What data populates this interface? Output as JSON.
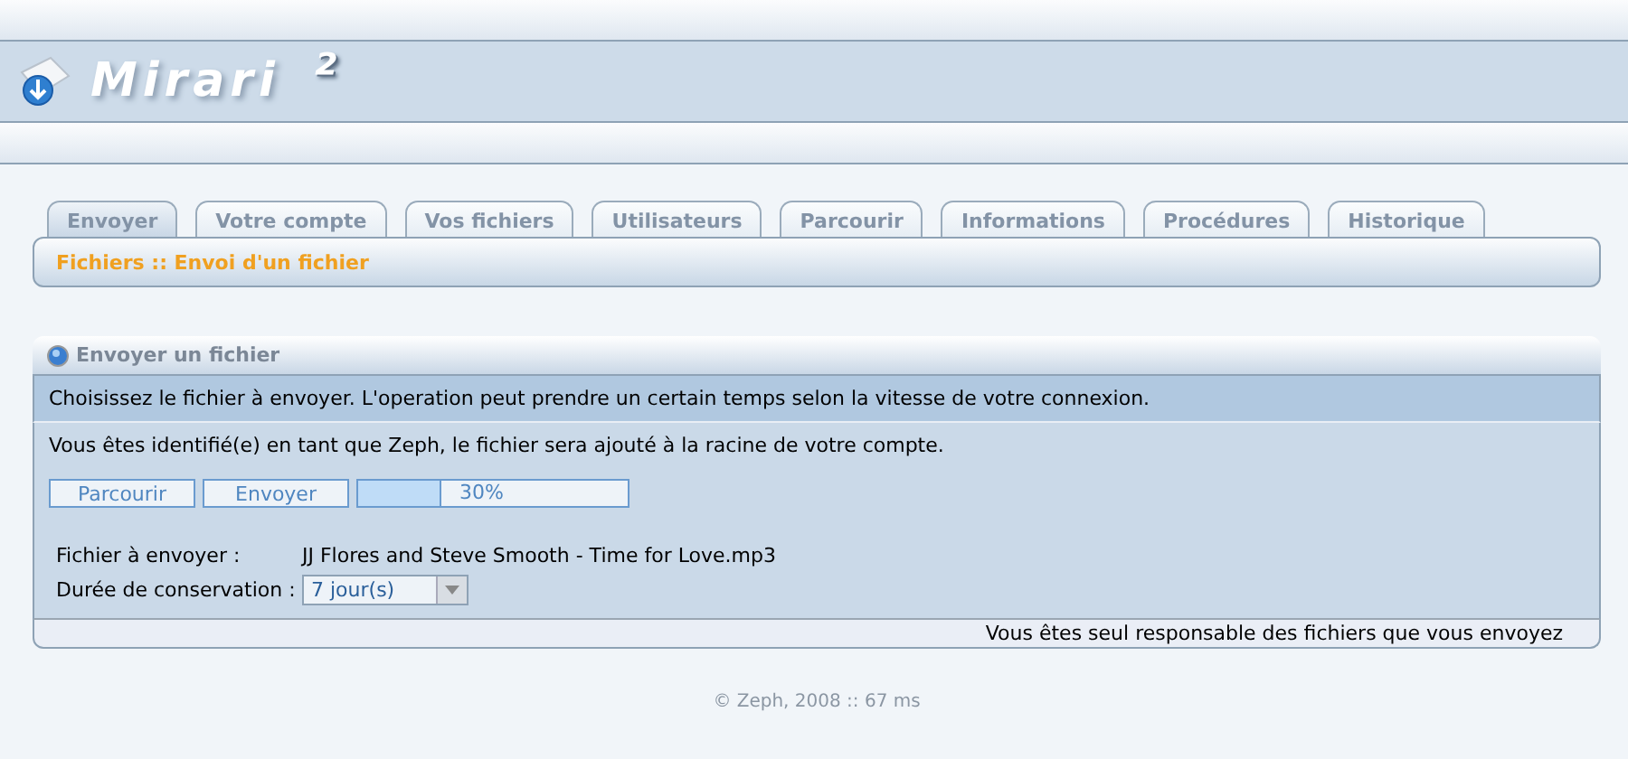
{
  "header": {
    "logo": "Mirari",
    "logo_sup": "²"
  },
  "tabs": [
    {
      "label": "Envoyer",
      "selected": true
    },
    {
      "label": "Votre compte",
      "selected": false
    },
    {
      "label": "Vos fichiers",
      "selected": false
    },
    {
      "label": "Utilisateurs",
      "selected": false
    },
    {
      "label": "Parcourir",
      "selected": false
    },
    {
      "label": "Informations",
      "selected": false
    },
    {
      "label": "Procédures",
      "selected": false
    },
    {
      "label": "Historique",
      "selected": false
    }
  ],
  "breadcrumb": "Fichiers :: Envoi d'un fichier",
  "panel": {
    "title": "Envoyer un fichier",
    "notice": "Choisissez le fichier à envoyer. L'operation peut prendre un certain temps selon la vitesse de votre connexion.",
    "identity": "Vous êtes identifié(e) en tant que Zeph, le fichier sera ajouté à la racine de votre compte.",
    "buttons": [
      "Parcourir",
      "Envoyer"
    ],
    "progress": {
      "level": 0.3,
      "reading": "30%"
    },
    "file_label": "Fichier à envoyer :",
    "file_name": "JJ Flores and Steve Smooth - Time for Love.mp3",
    "duration_label": "Durée de conservation :",
    "duration_value": "7 jour(s)",
    "footer": "Vous êtes seul responsable des fichiers que vous envoyez"
  },
  "copyright": "© Zeph, 2008 :: 67 ms"
}
